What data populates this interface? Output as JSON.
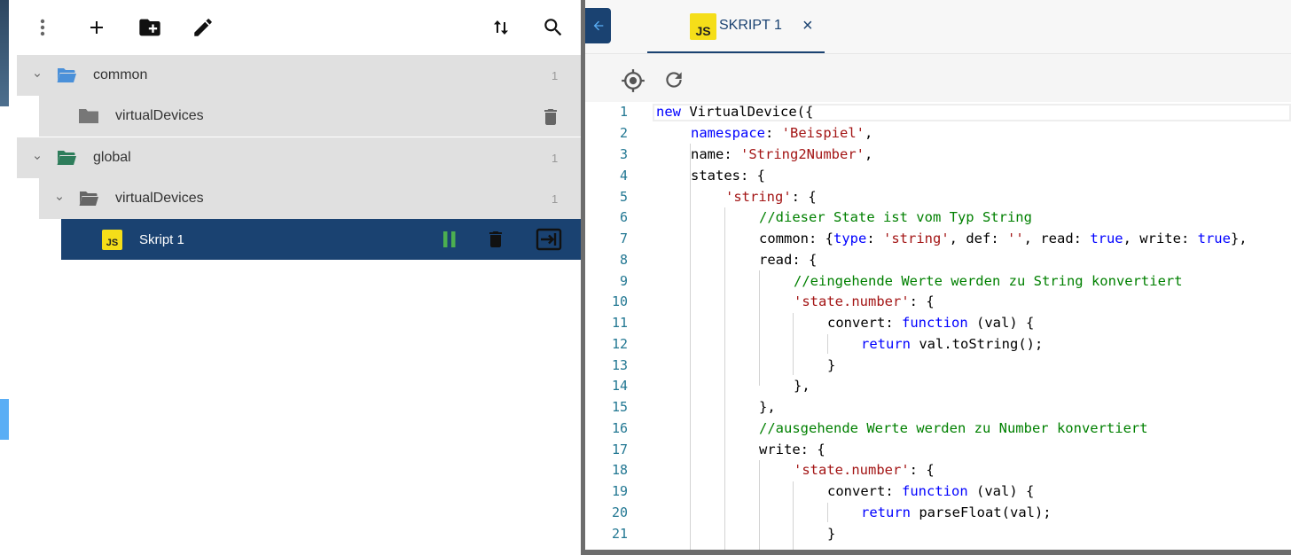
{
  "tree": {
    "items": [
      {
        "label": "common",
        "count": "1"
      },
      {
        "label": "virtualDevices"
      },
      {
        "label": "global",
        "count": "1"
      },
      {
        "label": "virtualDevices",
        "count": "1"
      },
      {
        "label": "Skript 1",
        "badge": "JS"
      }
    ]
  },
  "tab": {
    "badge": "JS",
    "label": "SKRIPT 1",
    "close": "×"
  },
  "editor": {
    "lines": [
      "1",
      "2",
      "3",
      "4",
      "5",
      "6",
      "7",
      "8",
      "9",
      "10",
      "11",
      "12",
      "13",
      "14",
      "15",
      "16",
      "17",
      "18",
      "19",
      "20",
      "21"
    ],
    "code": {
      "l1a": "new",
      "l1b": " VirtualDevice({",
      "l2a": "namespace",
      "l2b": ": ",
      "l2c": "'Beispiel'",
      "l2d": ",",
      "l3a": "name: ",
      "l3b": "'String2Number'",
      "l3c": ",",
      "l4": "states: {",
      "l5a": "'string'",
      "l5b": ": {",
      "l6": "//dieser State ist vom Typ String",
      "l7a": "common: {",
      "l7b": "type",
      "l7c": ": ",
      "l7d": "'string'",
      "l7e": ", def: ",
      "l7f": "''",
      "l7g": ", read: ",
      "l7h": "true",
      "l7i": ", write: ",
      "l7j": "true",
      "l7k": "},",
      "l8": "read: {",
      "l9": "//eingehende Werte werden zu String konvertiert",
      "l10a": "'state.number'",
      "l10b": ": {",
      "l11a": "convert: ",
      "l11b": "function",
      "l11c": " (val) {",
      "l12a": "return",
      "l12b": " val.toString();",
      "l13": "}",
      "l14": "},",
      "l15": "},",
      "l16": "//ausgehende Werte werden zu Number konvertiert",
      "l17": "write: {",
      "l18a": "'state.number'",
      "l18b": ": {",
      "l19a": "convert: ",
      "l19b": "function",
      "l19c": " (val) {",
      "l20a": "return",
      "l20b": " parseFloat(val);",
      "l21": "}"
    }
  },
  "colors": {
    "accent": "#1a4271",
    "folder_blue": "#4a90d9",
    "folder_green": "#2e7d5b",
    "run_green": "#4caf50"
  }
}
